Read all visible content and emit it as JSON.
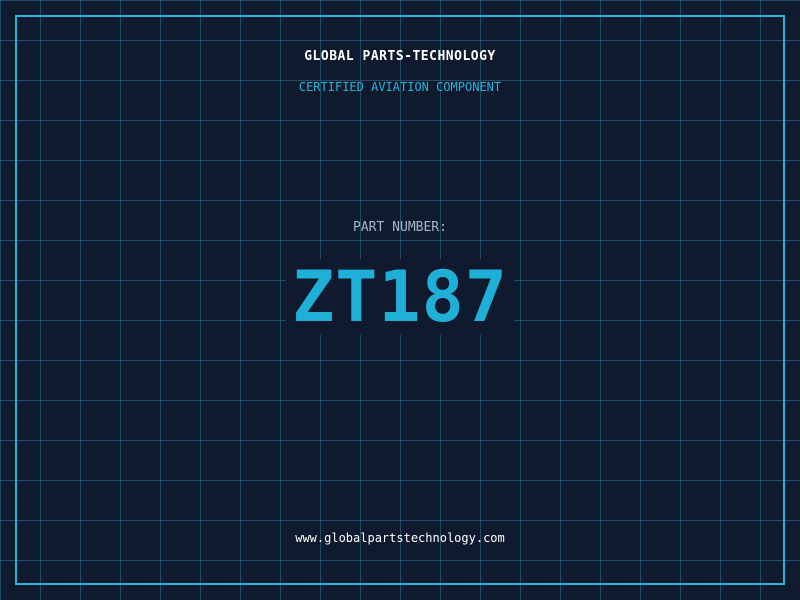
{
  "header": {
    "company_name": "GLOBAL PARTS-TECHNOLOGY",
    "tagline": "CERTIFIED AVIATION COMPONENT"
  },
  "part": {
    "label": "PART NUMBER:",
    "number": "ZT187"
  },
  "footer": {
    "website": "www.globalpartstechnology.com"
  },
  "colors": {
    "background": "#0f1a2e",
    "accent": "#29b3d9",
    "grid": "#26789a",
    "text_primary": "#ffffff",
    "text_muted": "#a9b4c4"
  }
}
